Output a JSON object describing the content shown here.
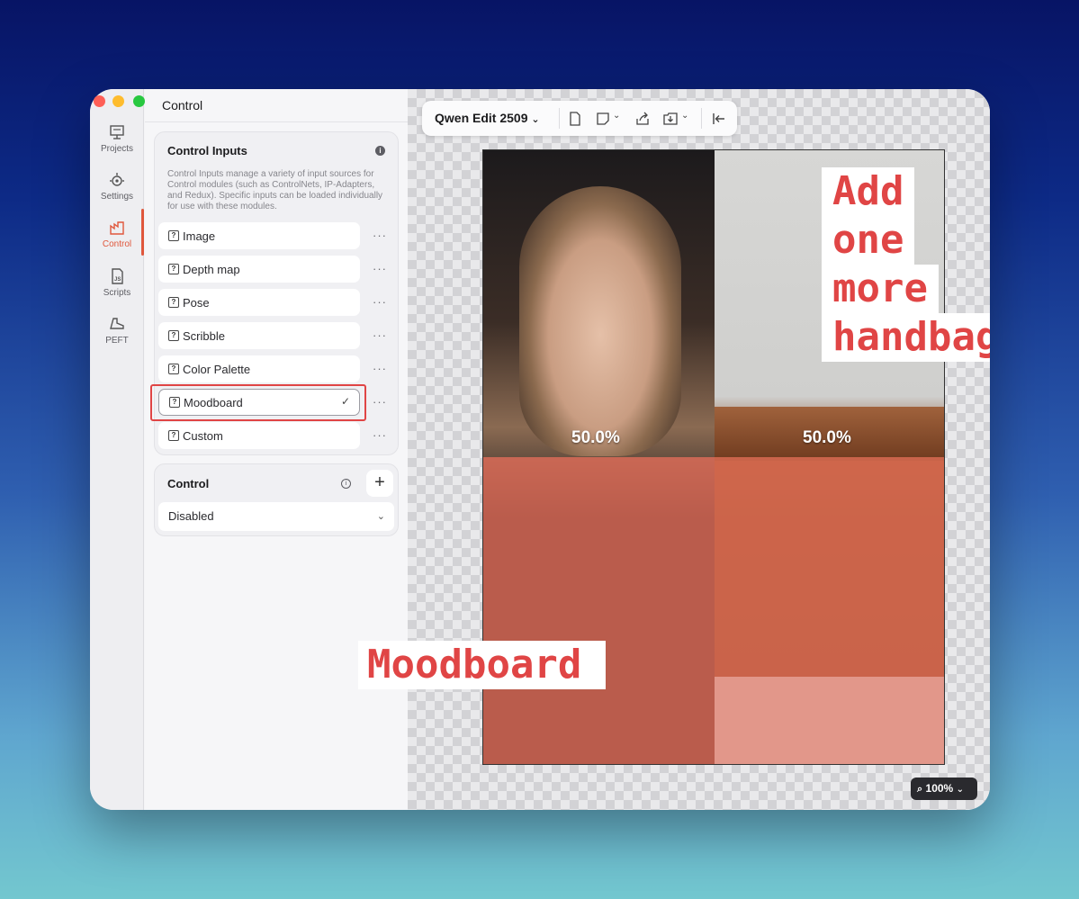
{
  "app": {
    "panel_title": "Control"
  },
  "rail": {
    "items": [
      {
        "label": "Projects",
        "icon": "projects-icon"
      },
      {
        "label": "Settings",
        "icon": "settings-icon"
      },
      {
        "label": "Control",
        "icon": "control-icon",
        "active": true
      },
      {
        "label": "Scripts",
        "icon": "scripts-icon"
      },
      {
        "label": "PEFT",
        "icon": "peft-icon"
      }
    ],
    "active_color": "#e0573c"
  },
  "control_inputs": {
    "title": "Control Inputs",
    "description": "Control Inputs manage a variety of input sources for Control modules (such as ControlNets, IP-Adapters, and Redux). Specific inputs can be loaded individually for use with these modules.",
    "items": [
      {
        "label": "Image"
      },
      {
        "label": "Depth map"
      },
      {
        "label": "Pose"
      },
      {
        "label": "Scribble"
      },
      {
        "label": "Color Palette"
      },
      {
        "label": "Moodboard",
        "selected": true
      },
      {
        "label": "Custom"
      }
    ],
    "more_label": "···"
  },
  "control": {
    "title": "Control",
    "add_label": "+",
    "selected_value": "Disabled"
  },
  "toolbar": {
    "model_name": "Qwen Edit 2509"
  },
  "canvas": {
    "left_strength": "50.0%",
    "right_strength": "50.0%",
    "annotation_lines": [
      "Add",
      "one",
      "more",
      "handbag"
    ],
    "label_overlay": "Moodboard",
    "zoom": "100%"
  },
  "colors": {
    "highlight": "#e04545",
    "mask": "#e66e5a"
  }
}
